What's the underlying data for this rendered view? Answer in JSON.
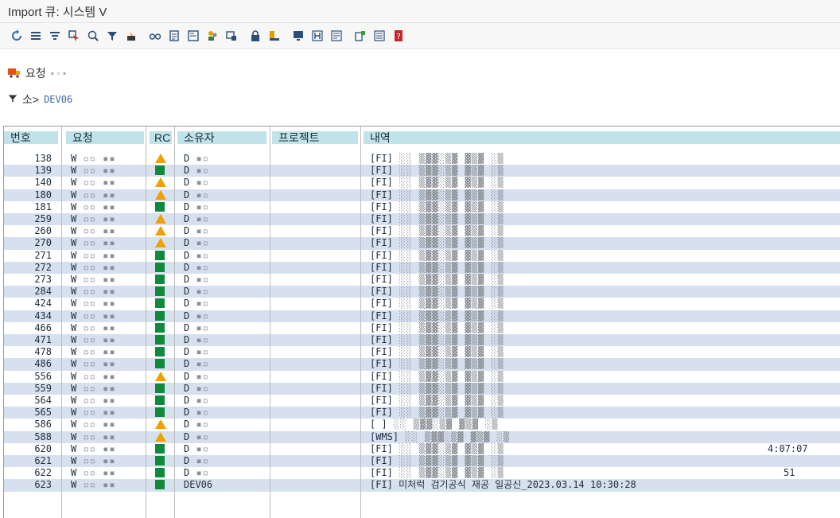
{
  "window": {
    "title": "Import 큐: 시스템 V"
  },
  "toolbar": {
    "icons": [
      "refresh-icon",
      "collapse-icon",
      "expand-icon",
      "select-icon",
      "zoom-icon",
      "filter-icon",
      "tools-icon",
      "glasses-icon",
      "document-icon",
      "form-icon",
      "users-icon",
      "transport-icon",
      "lock-icon",
      "person-icon",
      "monitor-icon",
      "h-icon",
      "log-icon",
      "share-icon",
      "list-icon",
      "help-book-icon"
    ]
  },
  "info": {
    "request_label": "요청",
    "filter_label": "소>",
    "filter_value": "DEV06"
  },
  "table": {
    "headers": [
      "번호",
      "요청",
      "RC",
      "소유자",
      "프로젝트",
      "내역"
    ],
    "rows": [
      {
        "num": "138",
        "req": "W",
        "rc": "warn",
        "owner": "D",
        "desc": "[FI]"
      },
      {
        "num": "139",
        "req": "W",
        "rc": "ok",
        "owner": "D",
        "desc": "[FI]"
      },
      {
        "num": "140",
        "req": "W",
        "rc": "warn",
        "owner": "D",
        "desc": "[FI]"
      },
      {
        "num": "180",
        "req": "W",
        "rc": "warn",
        "owner": "D",
        "desc": "[FI]"
      },
      {
        "num": "181",
        "req": "W",
        "rc": "ok",
        "owner": "D",
        "desc": "[FI]"
      },
      {
        "num": "259",
        "req": "W",
        "rc": "warn",
        "owner": "D",
        "desc": "[FI]"
      },
      {
        "num": "260",
        "req": "W",
        "rc": "warn",
        "owner": "D",
        "desc": "[FI]"
      },
      {
        "num": "270",
        "req": "W",
        "rc": "warn",
        "owner": "D",
        "desc": "[FI]"
      },
      {
        "num": "271",
        "req": "W",
        "rc": "ok",
        "owner": "D",
        "desc": "[FI]"
      },
      {
        "num": "272",
        "req": "W",
        "rc": "ok",
        "owner": "D",
        "desc": "[FI]"
      },
      {
        "num": "273",
        "req": "W",
        "rc": "ok",
        "owner": "D",
        "desc": "[FI]"
      },
      {
        "num": "284",
        "req": "W",
        "rc": "ok",
        "owner": "D",
        "desc": "[FI]"
      },
      {
        "num": "424",
        "req": "W",
        "rc": "ok",
        "owner": "D",
        "desc": "[FI]"
      },
      {
        "num": "434",
        "req": "W",
        "rc": "ok",
        "owner": "D",
        "desc": "[FI]"
      },
      {
        "num": "466",
        "req": "W",
        "rc": "ok",
        "owner": "D",
        "desc": "[FI]"
      },
      {
        "num": "471",
        "req": "W",
        "rc": "ok",
        "owner": "D",
        "desc": "[FI]"
      },
      {
        "num": "478",
        "req": "W",
        "rc": "ok",
        "owner": "D",
        "desc": "[FI]"
      },
      {
        "num": "486",
        "req": "W",
        "rc": "ok",
        "owner": "D",
        "desc": "[FI]"
      },
      {
        "num": "556",
        "req": "W",
        "rc": "warn",
        "owner": "D",
        "desc": "[FI]"
      },
      {
        "num": "559",
        "req": "W",
        "rc": "ok",
        "owner": "D",
        "desc": "[FI]"
      },
      {
        "num": "564",
        "req": "W",
        "rc": "ok",
        "owner": "D",
        "desc": "[FI]"
      },
      {
        "num": "565",
        "req": "W",
        "rc": "ok",
        "owner": "D",
        "desc": "[FI]"
      },
      {
        "num": "586",
        "req": "W",
        "rc": "warn",
        "owner": "D",
        "desc": "[  ]"
      },
      {
        "num": "588",
        "req": "W",
        "rc": "warn",
        "owner": "D",
        "desc": "[WMS]"
      },
      {
        "num": "620",
        "req": "W",
        "rc": "ok",
        "owner": "D",
        "desc": "[FI]",
        "tail": "4:07:07"
      },
      {
        "num": "621",
        "req": "W",
        "rc": "ok",
        "owner": "D",
        "desc": "[FI]"
      },
      {
        "num": "622",
        "req": "W",
        "rc": "ok",
        "owner": "D",
        "desc": "[FI]",
        "tail": "51"
      },
      {
        "num": "623",
        "req": "W",
        "rc": "ok",
        "owner": "DEV06",
        "desc": "[FI] 미처럭 검기공식 재공 일공신_2023.03.14 10:30:28"
      }
    ]
  },
  "colors": {
    "header_bg": "#bfe3e8",
    "row_alt": "#d6e0ee",
    "ok": "#0f8a3c",
    "warn": "#f0a000"
  }
}
